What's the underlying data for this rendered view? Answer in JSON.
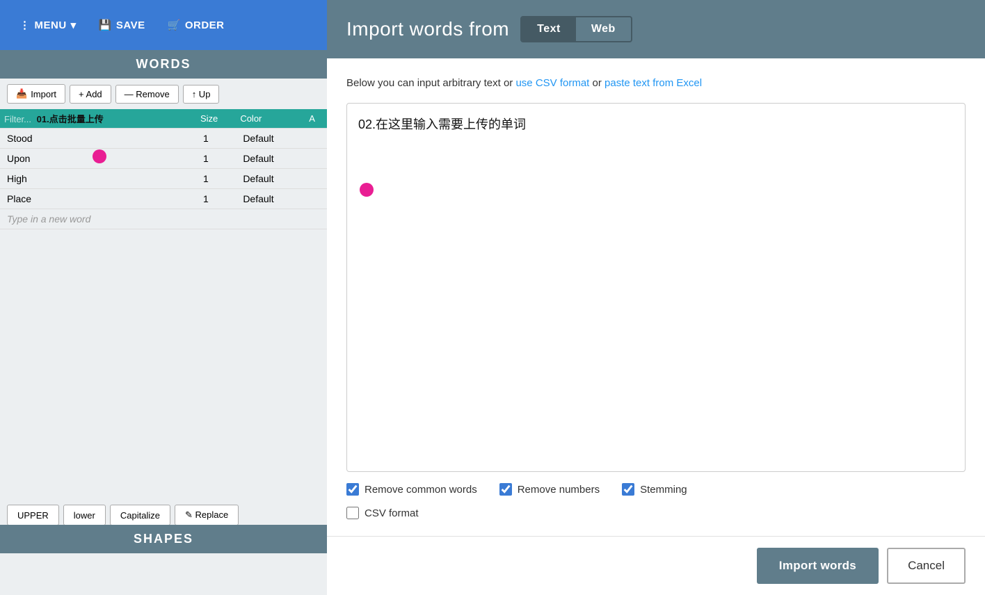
{
  "toolbar": {
    "menu_label": "MENU",
    "save_label": "SAVE",
    "order_label": "ORDER"
  },
  "words_panel": {
    "header": "WORDS",
    "actions": {
      "import": "Import",
      "add": "+ Add",
      "remove": "— Remove",
      "up": "↑ Up"
    },
    "columns": {
      "filter_placeholder": "Filter...",
      "size": "Size",
      "color": "Color",
      "angle": "A"
    },
    "rows": [
      {
        "word": "Stood",
        "size": "1",
        "color": "Default"
      },
      {
        "word": "Upon",
        "size": "1",
        "color": "Default"
      },
      {
        "word": "High",
        "size": "1",
        "color": "Default"
      },
      {
        "word": "Place",
        "size": "1",
        "color": "Default"
      }
    ],
    "new_word_placeholder": "Type in a new word"
  },
  "case_buttons": [
    "UPPER",
    "lower",
    "Capitalize",
    "Replace"
  ],
  "shapes_header": "SHAPES",
  "annotation": {
    "dot1": "01.点击批量上传",
    "dot2": "02.在这里输入需要上传的单词"
  },
  "modal": {
    "title": "Import words from",
    "tab_text": "Text",
    "tab_web": "Web",
    "description_part1": "Below you can input arbitrary text or",
    "link_csv": "use CSV format",
    "description_or": "or",
    "link_excel": "paste text from Excel",
    "textarea_content": "02.在这里输入需要上传的单词",
    "options": [
      {
        "label": "Remove common words",
        "checked": true
      },
      {
        "label": "Remove numbers",
        "checked": true
      },
      {
        "label": "Stemming",
        "checked": true
      },
      {
        "label": "CSV format",
        "checked": false
      }
    ],
    "btn_import": "Import words",
    "btn_cancel": "Cancel"
  }
}
